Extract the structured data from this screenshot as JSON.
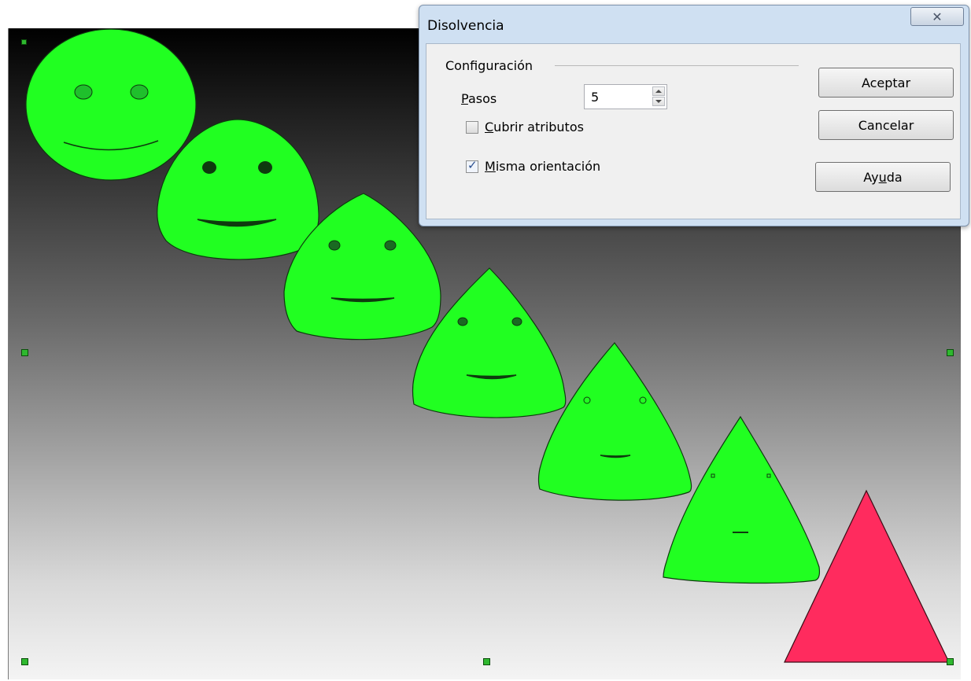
{
  "dialog": {
    "title": "Disolvencia",
    "close_icon": "close-x-icon",
    "group_label": "Configuración",
    "steps": {
      "label_first": "P",
      "label_rest": "asos",
      "value": "5"
    },
    "cover_attributes": {
      "label_first": "C",
      "label_rest": "ubrir atributos",
      "checked": false
    },
    "same_orientation": {
      "label_first": "M",
      "label_rest": "isma orientación",
      "checked": true
    },
    "buttons": {
      "ok": "Aceptar",
      "cancel": "Cancelar",
      "help_a": "Ay",
      "help_u": "u",
      "help_b": "da"
    }
  },
  "drawing": {
    "shapes": [
      {
        "kind": "ellipse",
        "fill": "#21ff21"
      },
      {
        "kind": "morph-step",
        "fill": "#21ff21"
      },
      {
        "kind": "morph-step",
        "fill": "#21ff21"
      },
      {
        "kind": "morph-step",
        "fill": "#21ff21"
      },
      {
        "kind": "morph-step",
        "fill": "#21ff21"
      },
      {
        "kind": "morph-step",
        "fill": "#21ff21"
      },
      {
        "kind": "triangle",
        "fill": "#ff2b5e"
      }
    ],
    "background_gradient": [
      "#000000",
      "#f4f4f4"
    ],
    "handle_color": "#2fb82f"
  }
}
